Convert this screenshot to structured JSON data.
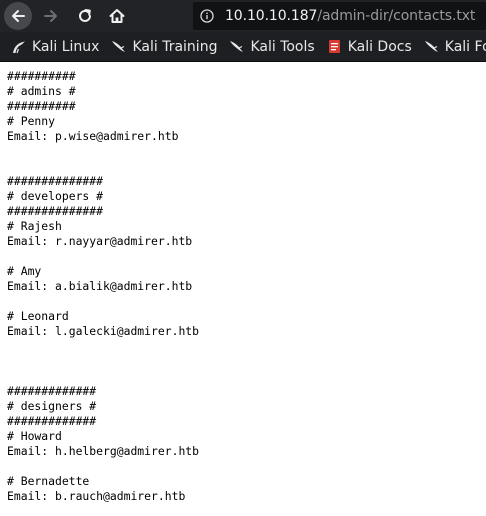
{
  "browser": {
    "url_host": "10.10.10.187",
    "url_path": "/admin-dir/contacts.txt",
    "colors": {
      "toolbar_bg": "#222326",
      "bookmarks_bg": "#1e1f22",
      "urlbar_bg": "#111213",
      "page_bg": "#ffffff"
    }
  },
  "bookmarks": [
    {
      "label": "Kali Linux",
      "icon": "kali-dragon-icon"
    },
    {
      "label": "Kali Training",
      "icon": "kali-dragon-icon"
    },
    {
      "label": "Kali Tools",
      "icon": "kali-dragon-icon"
    },
    {
      "label": "Kali Docs",
      "icon": "kali-docs-icon"
    },
    {
      "label": "Kali Foru",
      "icon": "kali-dragon-icon"
    }
  ],
  "document": {
    "lines": [
      "##########",
      "# admins #",
      "##########",
      "# Penny",
      "Email: p.wise@admirer.htb",
      "",
      "",
      "##############",
      "# developers #",
      "##############",
      "# Rajesh",
      "Email: r.nayyar@admirer.htb",
      "",
      "# Amy",
      "Email: a.bialik@admirer.htb",
      "",
      "# Leonard",
      "Email: l.galecki@admirer.htb",
      "",
      "",
      "",
      "#############",
      "# designers #",
      "#############",
      "# Howard",
      "Email: h.helberg@admirer.htb",
      "",
      "# Bernadette",
      "Email: b.rauch@admirer.htb"
    ]
  }
}
